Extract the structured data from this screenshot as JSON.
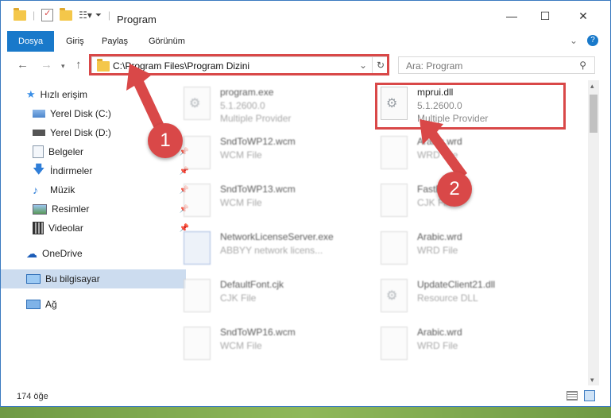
{
  "window": {
    "title": "Program"
  },
  "ribbon": {
    "tabs": [
      "Dosya",
      "Giriş",
      "Paylaş",
      "Görünüm"
    ]
  },
  "address": {
    "path": "C:\\Program Files\\Program Dizini"
  },
  "search": {
    "placeholder": "Ara: Program"
  },
  "sidebar": {
    "quick_access": "Hızlı erişim",
    "items": [
      "Yerel Disk (C:)",
      "Yerel Disk (D:)",
      "Belgeler",
      "İndirmeler",
      "Müzik",
      "Resimler",
      "Videolar"
    ],
    "onedrive": "OneDrive",
    "this_pc": "Bu bilgisayar",
    "network": "Ağ"
  },
  "files": [
    {
      "name": "program.exe",
      "line1": "5.1.2600.0",
      "line2": "Multiple Provider"
    },
    {
      "name": "mprui.dll",
      "line1": "5.1.2600.0",
      "line2": "Multiple Provider"
    },
    {
      "name": "SndToWP12.wcm",
      "line1": "WCM File",
      "line2": ""
    },
    {
      "name": "Arabic.wrd",
      "line1": "WRD File",
      "line2": ""
    },
    {
      "name": "SndToWP13.wcm",
      "line1": "WCM File",
      "line2": ""
    },
    {
      "name": "FastFont.cjk",
      "line1": "CJK File",
      "line2": ""
    },
    {
      "name": "NetworkLicenseServer.exe",
      "line1": "ABBYY network licens...",
      "line2": ""
    },
    {
      "name": "Arabic.wrd",
      "line1": "WRD File",
      "line2": ""
    },
    {
      "name": "DefaultFont.cjk",
      "line1": "CJK File",
      "line2": ""
    },
    {
      "name": "UpdateClient21.dll",
      "line1": "Resource DLL",
      "line2": ""
    },
    {
      "name": "SndToWP16.wcm",
      "line1": "WCM File",
      "line2": ""
    },
    {
      "name": "Arabic.wrd",
      "line1": "WRD File",
      "line2": ""
    }
  ],
  "status": {
    "count": "174 öğe"
  },
  "callouts": [
    "1",
    "2"
  ],
  "colors": {
    "accent": "#1979ca",
    "highlight": "#d94848",
    "selection": "#ccdcef"
  }
}
